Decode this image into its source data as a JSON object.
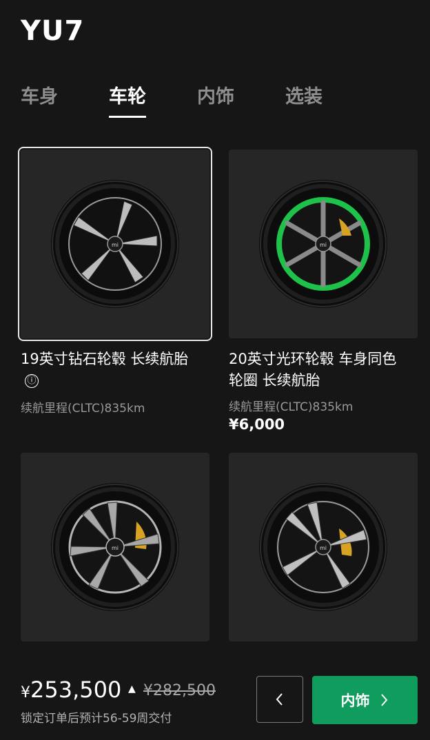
{
  "brand": "YU7",
  "tabs": [
    {
      "label": "车身",
      "active": false
    },
    {
      "label": "车轮",
      "active": true
    },
    {
      "label": "内饰",
      "active": false
    },
    {
      "label": "选装",
      "active": false
    }
  ],
  "wheels": [
    {
      "name": "19英寸钻石轮毂 长续航胎",
      "range": "续航里程(CLTC)835km",
      "selected": true,
      "has_info": true,
      "info_icon": "ⓘ"
    },
    {
      "name": "20英寸光环轮毂 车身同色轮圈 长续航胎",
      "range": "续航里程(CLTC)835km",
      "price": "¥6,000",
      "selected": false
    },
    {
      "name": "",
      "selected": false
    },
    {
      "name": "",
      "selected": false
    }
  ],
  "footer": {
    "currency": "¥",
    "price": "253,500",
    "price_trend_icon": "caret-up",
    "original_price": "¥282,500",
    "delivery": "锁定订单后预计56-59周交付",
    "prev_icon": "chevron-left",
    "next_label": "内饰",
    "next_icon": "chevron-right"
  },
  "colors": {
    "background": "#161616",
    "card": "#262626",
    "accent_green": "#109c5c",
    "ring_green": "#1ec14a",
    "caliper_yellow": "#d6a422"
  }
}
